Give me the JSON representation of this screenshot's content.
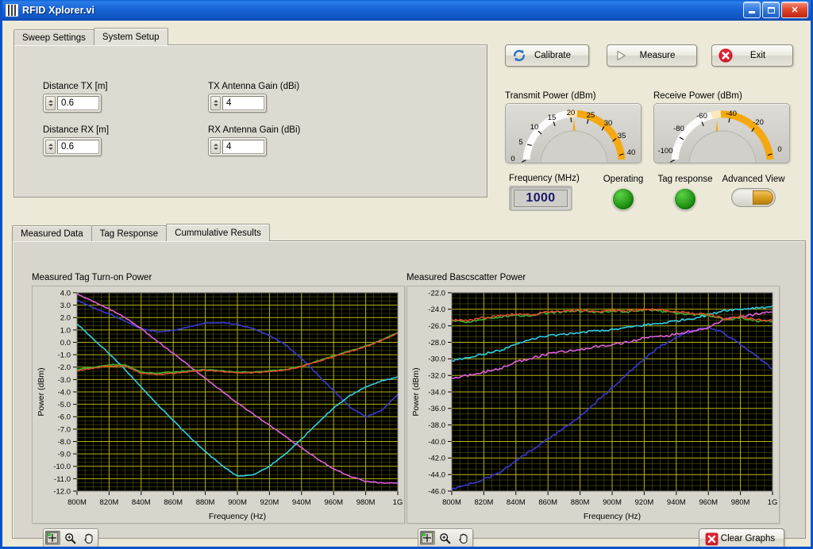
{
  "window": {
    "title": "RFID Xplorer.vi",
    "icon": "labview-vi-icon",
    "minimize_label": "",
    "maximize_label": "",
    "close_label": "✕"
  },
  "upper_tabs": {
    "items": [
      {
        "label": "Sweep Settings",
        "active": false
      },
      {
        "label": "System Setup",
        "active": true
      }
    ]
  },
  "system_setup": {
    "fields": [
      {
        "label": "Distance TX [m]",
        "value": "0.6"
      },
      {
        "label": "Distance RX [m]",
        "value": "0.6"
      },
      {
        "label": "TX Antenna Gain (dBi)",
        "value": "4"
      },
      {
        "label": "RX Antenna Gain (dBi)",
        "value": "4"
      }
    ]
  },
  "actions": {
    "calibrate": {
      "label": "Calibrate",
      "icon": "refresh-icon"
    },
    "measure": {
      "label": "Measure",
      "icon": "play-icon"
    },
    "exit": {
      "label": "Exit",
      "icon": "close-circle-icon"
    }
  },
  "gauges": {
    "transmit": {
      "title": "Transmit Power (dBm)",
      "min": 0,
      "max": 40,
      "ticks": [
        "0",
        "5",
        "10",
        "15",
        "20",
        "25",
        "30",
        "35",
        "40"
      ],
      "value": 22,
      "fill_color": "#f5a80f"
    },
    "receive": {
      "title": "Receive Power (dBm)",
      "min": -100,
      "max": 0,
      "ticks": [
        "-100",
        "-80",
        "-60",
        "-40",
        "-20",
        "0"
      ],
      "value": -57,
      "fill_color": "#f5a80f"
    }
  },
  "frequency": {
    "label": "Frequency (MHz)",
    "value": "1000"
  },
  "indicators": [
    {
      "label": "Operating",
      "type": "led",
      "state": "on"
    },
    {
      "label": "Tag response",
      "type": "led",
      "state": "on"
    },
    {
      "label": "Advanced View",
      "type": "toggle",
      "state": "on"
    }
  ],
  "lower_tabs": {
    "items": [
      {
        "label": "Measured Data",
        "active": false
      },
      {
        "label": "Tag Response",
        "active": false
      },
      {
        "label": "Cummulative Results",
        "active": true
      }
    ]
  },
  "graph_palette": {
    "tools": [
      {
        "name": "cursor-tool",
        "selected": true
      },
      {
        "name": "zoom-tool",
        "selected": false
      },
      {
        "name": "pan-tool",
        "selected": false
      }
    ]
  },
  "clear_button": {
    "label": "Clear Graphs",
    "icon": "close-box-icon"
  },
  "chart_data": [
    {
      "id": "turn-on-power",
      "type": "line",
      "title": "Measured Tag Turn-on Power",
      "xlabel": "Frequency (Hz)",
      "ylabel": "Power (dBm)",
      "xlim": [
        800,
        1000
      ],
      "ylim": [
        -12.0,
        4.0
      ],
      "xticks": [
        "800M",
        "820M",
        "840M",
        "860M",
        "880M",
        "900M",
        "920M",
        "940M",
        "960M",
        "980M",
        "1G"
      ],
      "yticks": [
        "4.0",
        "3.0",
        "2.0",
        "1.0",
        "0.0",
        "-1.0",
        "-2.0",
        "-3.0",
        "-4.0",
        "-5.0",
        "-6.0",
        "-7.0",
        "-8.0",
        "-9.0",
        "-10.0",
        "-11.0",
        "-12.0"
      ],
      "grid": true,
      "plot_bg": "#000000",
      "grid_color": "#b8b800",
      "x": [
        800,
        810,
        820,
        830,
        840,
        850,
        860,
        870,
        880,
        890,
        900,
        910,
        920,
        930,
        940,
        950,
        960,
        970,
        980,
        990,
        1000
      ],
      "series": [
        {
          "name": "trace-blue",
          "color": "#3838d8",
          "values": [
            3.4,
            2.8,
            2.3,
            1.7,
            1.1,
            0.85,
            0.95,
            1.25,
            1.55,
            1.6,
            1.45,
            1.1,
            0.55,
            -0.2,
            -1.3,
            -2.6,
            -3.9,
            -5.2,
            -6.0,
            -5.5,
            -4.2
          ]
        },
        {
          "name": "trace-magenta",
          "color": "#e060e0",
          "values": [
            3.9,
            3.3,
            2.7,
            2.0,
            1.1,
            0.1,
            -0.9,
            -1.9,
            -2.9,
            -3.9,
            -4.9,
            -5.8,
            -6.7,
            -7.6,
            -8.5,
            -9.4,
            -10.2,
            -10.8,
            -11.2,
            -11.35,
            -11.35
          ]
        },
        {
          "name": "trace-cyan",
          "color": "#2fd0e8",
          "values": [
            1.5,
            0.3,
            -0.9,
            -2.2,
            -3.6,
            -5.0,
            -6.3,
            -7.6,
            -8.8,
            -9.9,
            -10.8,
            -10.7,
            -10.0,
            -9.0,
            -7.8,
            -6.5,
            -5.3,
            -4.3,
            -3.6,
            -3.1,
            -2.8
          ]
        },
        {
          "name": "trace-green",
          "color": "#2fc02f",
          "values": [
            -2.2,
            -2.0,
            -1.8,
            -1.8,
            -2.4,
            -2.5,
            -2.4,
            -2.3,
            -2.2,
            -2.3,
            -2.4,
            -2.4,
            -2.3,
            -2.2,
            -1.9,
            -1.5,
            -1.1,
            -0.7,
            -0.3,
            0.2,
            0.8
          ]
        },
        {
          "name": "trace-red",
          "color": "#e04a2c",
          "values": [
            -2.3,
            -2.1,
            -1.9,
            -1.9,
            -2.5,
            -2.6,
            -2.5,
            -2.35,
            -2.25,
            -2.35,
            -2.45,
            -2.45,
            -2.35,
            -2.25,
            -1.95,
            -1.55,
            -1.15,
            -0.75,
            -0.35,
            0.15,
            0.75
          ]
        }
      ]
    },
    {
      "id": "backscatter-power",
      "type": "line",
      "title": "Measured Bascscatter Power",
      "xlabel": "Frequency (Hz)",
      "ylabel": "Power (dBm)",
      "xlim": [
        800,
        1000
      ],
      "ylim": [
        -46.0,
        -22.0
      ],
      "xticks": [
        "800M",
        "820M",
        "840M",
        "860M",
        "880M",
        "900M",
        "920M",
        "940M",
        "960M",
        "980M",
        "1G"
      ],
      "yticks": [
        "-22.0",
        "-24.0",
        "-26.0",
        "-28.0",
        "-30.0",
        "-32.0",
        "-34.0",
        "-36.0",
        "-38.0",
        "-40.0",
        "-42.0",
        "-44.0",
        "-46.0"
      ],
      "grid": true,
      "plot_bg": "#000000",
      "grid_color": "#b8b800",
      "x": [
        800,
        810,
        820,
        830,
        840,
        850,
        860,
        870,
        880,
        890,
        900,
        910,
        920,
        930,
        940,
        950,
        960,
        970,
        980,
        990,
        1000
      ],
      "series": [
        {
          "name": "trace-blue",
          "color": "#3838d8",
          "values": [
            -45.8,
            -45.2,
            -44.6,
            -43.8,
            -42.3,
            -41.0,
            -39.7,
            -38.4,
            -37.0,
            -35.2,
            -33.5,
            -31.7,
            -30.0,
            -28.5,
            -27.4,
            -26.6,
            -26.2,
            -26.9,
            -28.2,
            -29.7,
            -31.2
          ]
        },
        {
          "name": "trace-magenta",
          "color": "#e060e0",
          "values": [
            -32.4,
            -32.0,
            -31.6,
            -31.2,
            -30.4,
            -29.9,
            -29.4,
            -29.1,
            -28.9,
            -28.5,
            -28.3,
            -28.0,
            -27.5,
            -27.3,
            -27.0,
            -26.6,
            -26.2,
            -25.2,
            -24.9,
            -24.6,
            -24.3
          ]
        },
        {
          "name": "trace-cyan",
          "color": "#2fd0e8",
          "values": [
            -30.2,
            -29.8,
            -29.4,
            -29.0,
            -28.2,
            -27.6,
            -27.2,
            -27.0,
            -26.8,
            -26.6,
            -26.5,
            -26.2,
            -25.9,
            -25.7,
            -25.4,
            -25.1,
            -24.7,
            -24.1,
            -24.0,
            -23.8,
            -23.7
          ]
        },
        {
          "name": "trace-green",
          "color": "#2fc02f",
          "values": [
            -25.4,
            -25.5,
            -25.1,
            -24.9,
            -24.7,
            -24.8,
            -24.4,
            -24.3,
            -24.2,
            -24.4,
            -24.2,
            -24.3,
            -24.1,
            -24.2,
            -24.4,
            -24.6,
            -24.7,
            -25.3,
            -25.0,
            -25.4,
            -25.4
          ]
        },
        {
          "name": "trace-red",
          "color": "#e04a2c",
          "values": [
            -25.3,
            -25.4,
            -25.0,
            -24.8,
            -24.6,
            -24.7,
            -24.3,
            -24.2,
            -24.1,
            -24.3,
            -24.1,
            -24.2,
            -24.0,
            -24.1,
            -24.3,
            -24.5,
            -24.6,
            -25.2,
            -24.9,
            -25.3,
            -25.3
          ]
        }
      ]
    }
  ]
}
